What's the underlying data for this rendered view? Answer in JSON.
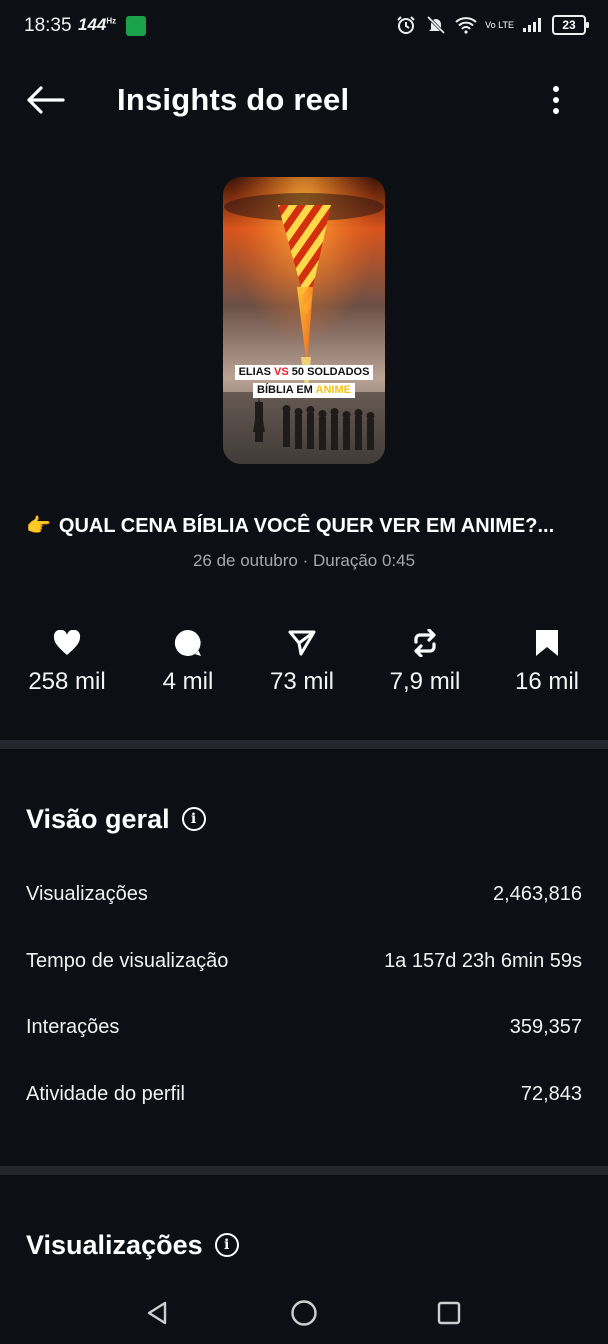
{
  "status_bar": {
    "time": "18:35",
    "refresh_rate": "144",
    "refresh_unit": "Hz",
    "network": "Vo LTE",
    "battery": "23"
  },
  "header": {
    "title": "Insights do reel",
    "back_icon": "arrow-left-icon",
    "more_icon": "more-vertical-icon"
  },
  "thumbnail": {
    "line1_a": "ELIAS ",
    "line1_vs": "VS",
    "line1_b": " 50 SOLDADOS",
    "line2_a": "BÍBLIA EM ",
    "line2_anime": "ANIME"
  },
  "reel": {
    "caption_emoji": "👉",
    "caption": "QUAL CENA BÍBLIA VOCÊ QUER VER EM ANIME?...",
    "meta": "26 de outubro · Duração 0:45"
  },
  "stats": [
    {
      "icon": "heart-icon",
      "value": "258 mil"
    },
    {
      "icon": "comment-icon",
      "value": "4 mil"
    },
    {
      "icon": "send-icon",
      "value": "73 mil"
    },
    {
      "icon": "repost-icon",
      "value": "7,9 mil"
    },
    {
      "icon": "bookmark-icon",
      "value": "16 mil"
    }
  ],
  "overview": {
    "title": "Visão geral",
    "rows": [
      {
        "label": "Visualizações",
        "value": "2,463,816"
      },
      {
        "label": "Tempo de visualização",
        "value": "1a 157d 23h 6min 59s"
      },
      {
        "label": "Interações",
        "value": "359,357"
      },
      {
        "label": "Atividade do perfil",
        "value": "72,843"
      }
    ]
  },
  "views_section": {
    "title": "Visualizações"
  },
  "colors": {
    "background": "#0c0f14",
    "divider": "#24272d",
    "muted_text": "#a6a8ad"
  }
}
